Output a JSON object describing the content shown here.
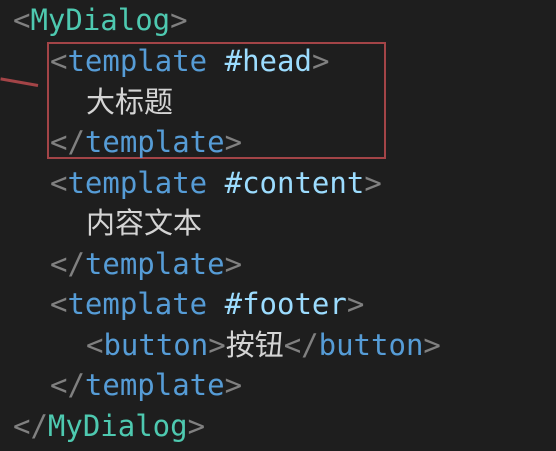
{
  "code": {
    "lines": [
      {
        "open": "<",
        "name": "MyDialog",
        "close": ">"
      },
      {
        "open": "<",
        "name": "template",
        "attr": "#head",
        "close": ">"
      },
      {
        "text": "大标题"
      },
      {
        "open": "</",
        "name": "template",
        "close": ">"
      },
      {
        "open": "<",
        "name": "template",
        "attr": "#content",
        "close": ">"
      },
      {
        "text": "内容文本"
      },
      {
        "open": "</",
        "name": "template",
        "close": ">"
      },
      {
        "open": "<",
        "name": "template",
        "attr": "#footer",
        "close": ">"
      },
      {
        "open": "<",
        "name": "button",
        "close": ">",
        "text": "按钮",
        "open2": "</",
        "name2": "button",
        "close2": ">"
      },
      {
        "open": "</",
        "name": "template",
        "close": ">"
      },
      {
        "open": "</",
        "name": "MyDialog",
        "close": ">"
      }
    ]
  },
  "colors": {
    "background": "#1e1e1e",
    "punctuation": "#808080",
    "html_tag": "#569cd6",
    "component_tag": "#4ec9b0",
    "slot_attr": "#9cdcfe",
    "text": "#d4d4d4",
    "highlight_border": "#a34447"
  }
}
